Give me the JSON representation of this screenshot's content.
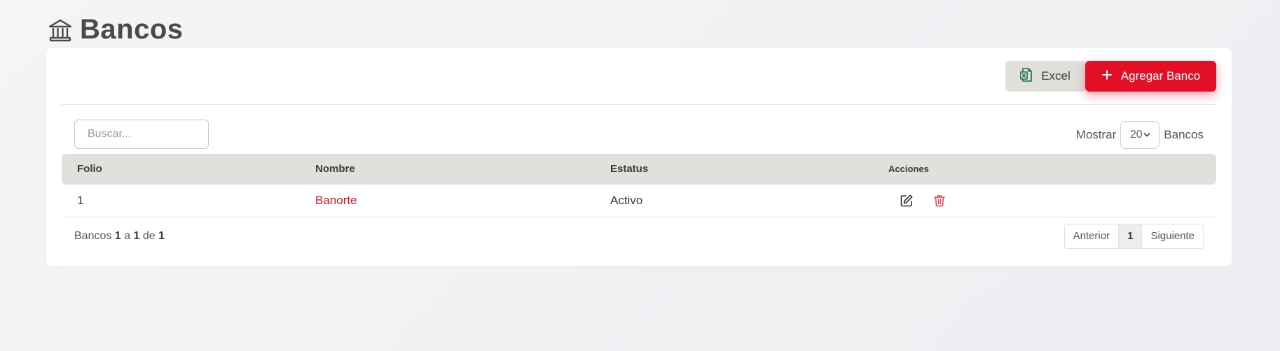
{
  "header": {
    "title": "Bancos",
    "icon": "bank-icon"
  },
  "toolbar": {
    "excel_label": "Excel",
    "excel_icon": "excel-file-icon",
    "add_label": "Agregar Banco",
    "add_icon": "plus-icon",
    "accent_color": "#e30f25"
  },
  "search": {
    "placeholder": "Buscar...",
    "value": ""
  },
  "page_size": {
    "prefix": "Mostrar",
    "value": "20",
    "suffix": "Bancos"
  },
  "table": {
    "columns": [
      "Folio",
      "Nombre",
      "Estatus",
      "Acciones"
    ],
    "rows": [
      {
        "folio": "1",
        "nombre": "Banorte",
        "estatus": "Activo",
        "actions": [
          "edit-icon",
          "trash-icon"
        ]
      }
    ]
  },
  "footer": {
    "label": "Bancos",
    "from": "1",
    "sep_a": "a",
    "to": "1",
    "sep_de": "de",
    "total": "1"
  },
  "pagination": {
    "prev": "Anterior",
    "current": "1",
    "next": "Siguiente"
  }
}
